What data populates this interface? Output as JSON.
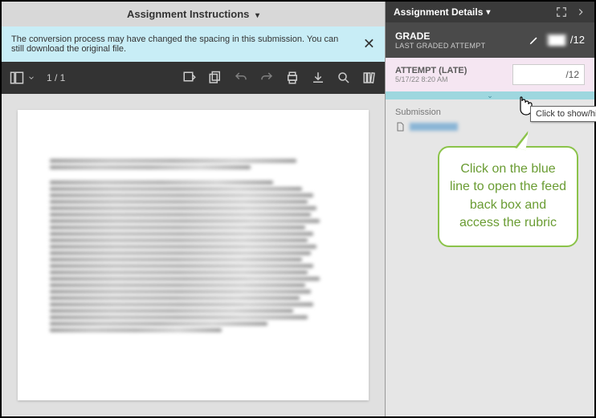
{
  "left": {
    "header_title": "Assignment Instructions",
    "notice": "The conversion process may have changed the spacing in this submission. You can still download the original file.",
    "page_indicator": "1 / 1"
  },
  "right": {
    "header_title": "Assignment Details",
    "grade": {
      "title": "GRADE",
      "subtitle": "LAST GRADED ATTEMPT",
      "max": "/12"
    },
    "attempt": {
      "title": "ATTEMPT (LATE)",
      "timestamp": "5/17/22 8:20 AM",
      "max": "/12"
    },
    "submission_label": "Submission",
    "tooltip": "Click to show/hide",
    "callout": "Click on the blue line to open the feed back box and access the rubric"
  }
}
